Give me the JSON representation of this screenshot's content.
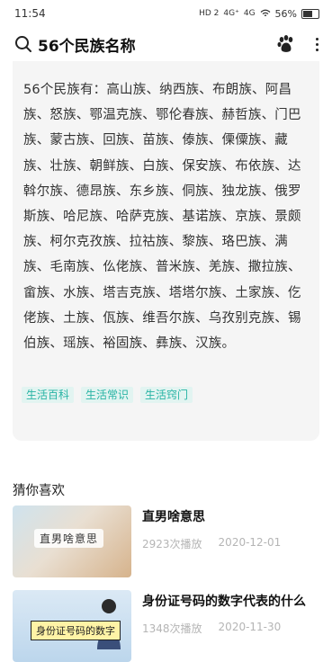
{
  "status_bar": {
    "time": "11:54",
    "signal_labels": [
      "HD 2",
      "4G⁺",
      "4G"
    ],
    "battery": "56%"
  },
  "search_bar": {
    "query": "56个民族名称"
  },
  "answer": {
    "text": "56个民族有：高山族、纳西族、布朗族、阿昌族、怒族、鄂温克族、鄂伦春族、赫哲族、门巴族、蒙古族、回族、苗族、傣族、傈僳族、藏族、壮族、朝鲜族、白族、保安族、布依族、达斡尔族、德昂族、东乡族、侗族、独龙族、俄罗斯族、哈尼族、哈萨克族、基诺族、京族、景颇族、柯尔克孜族、拉祜族、黎族、珞巴族、满族、毛南族、仫佬族、普米族、羌族、撒拉族、畲族、水族、塔吉克族、塔塔尔族、土家族、仡佬族、土族、佤族、维吾尔族、乌孜别克族、锡伯族、瑶族、裕固族、彝族、汉族。",
    "tags": [
      "生活百科",
      "生活常识",
      "生活窍门"
    ]
  },
  "recommendations": {
    "section_title": "猜你喜欢",
    "items": [
      {
        "title": "直男啥意思",
        "thumb_caption": "直男啥意思",
        "plays": "2923次播放",
        "date": "2020-12-01"
      },
      {
        "title": "身份证号码的数字代表的什么",
        "thumb_caption": "身份证号码的数字",
        "plays": "1348次播放",
        "date": "2020-11-30"
      }
    ]
  },
  "colors": {
    "accent": "#27b3a4",
    "tag_bg": "#e2f4f1",
    "card_bg": "#f5f5f5"
  },
  "icons": [
    "search-icon",
    "paw-icon",
    "more-icon"
  ]
}
